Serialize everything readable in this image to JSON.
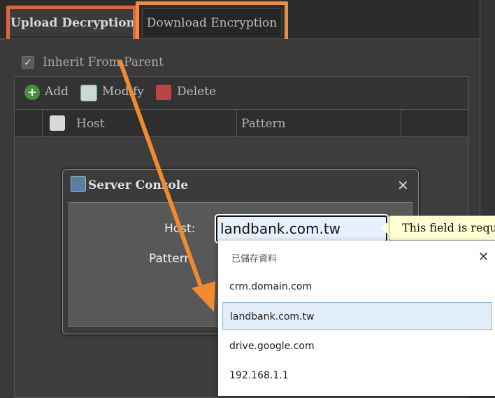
{
  "tabs": [
    {
      "label": "Upload Decryption",
      "active": true
    },
    {
      "label": "Download Encryption",
      "active": false
    }
  ],
  "inherit": {
    "label": "Inherit From Parent",
    "checked": true,
    "check_glyph": "✓"
  },
  "toolbar": {
    "add_label": "Add",
    "modify_label": "Modify",
    "delete_label": "Delete",
    "add_glyph": "+",
    "icons": [
      "add-icon",
      "modify-icon",
      "delete-icon"
    ]
  },
  "grid": {
    "columns": [
      "Host",
      "Pattern"
    ]
  },
  "console": {
    "title": "Server Console",
    "close_glyph": "✕",
    "host_label": "Host:",
    "pattern_label": "Pattern",
    "host_value": "landbank.com.tw",
    "tooltip": "This field is required"
  },
  "autocomplete": {
    "title": "已儲存資料",
    "close_glyph": "✕",
    "items": [
      "crm.domain.com",
      "landbank.com.tw",
      "drive.google.com",
      "192.168.1.1"
    ],
    "selected_index": 1
  },
  "colors": {
    "highlight_red": "#e0643d",
    "highlight_orange": "#ef8c3c",
    "arrow": "#f28a2e",
    "tooltip_bg": "#ffffd2",
    "selected_item_bg": "#e1eef9"
  }
}
